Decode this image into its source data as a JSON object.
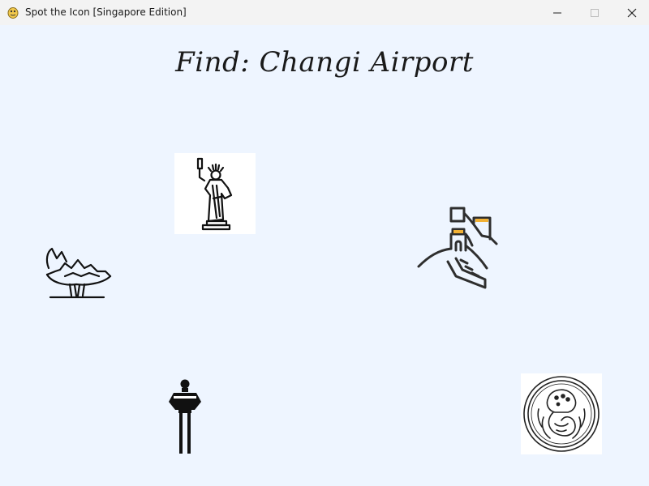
{
  "window": {
    "title": "Spot the Icon [Singapore Edition]",
    "app_icon": "pygame-snake-icon",
    "controls": [
      "minimize-icon",
      "maximize-icon",
      "close-icon"
    ]
  },
  "game": {
    "prompt": "Find: Changi Airport",
    "background_color": "#eef5ff",
    "icons": [
      {
        "name": "statue-of-liberty-icon"
      },
      {
        "name": "artscience-museum-icon"
      },
      {
        "name": "great-wall-icon"
      },
      {
        "name": "changi-control-tower-icon"
      },
      {
        "name": "merlion-coin-icon"
      }
    ]
  }
}
